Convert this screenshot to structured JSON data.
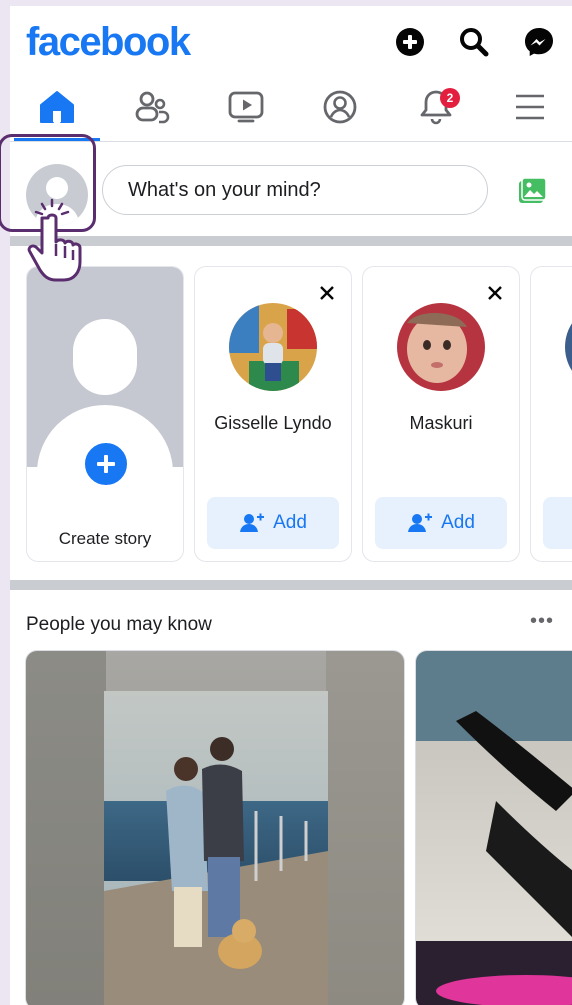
{
  "app": {
    "logo": "facebook"
  },
  "header": {
    "icons": [
      "create-icon",
      "search-icon",
      "messenger-icon"
    ]
  },
  "nav": {
    "tabs": [
      "home-tab",
      "friends-tab",
      "video-tab",
      "profile-tab",
      "notifications-tab",
      "menu-tab"
    ],
    "notification_count": "2"
  },
  "composer": {
    "placeholder": "What's on your mind?"
  },
  "stories": {
    "create_label": "Create story",
    "suggestions": [
      {
        "name": "Gisselle Lyndo",
        "add_label": "Add"
      },
      {
        "name": "Maskuri",
        "add_label": "Add"
      }
    ]
  },
  "pymk": {
    "title": "People you may know",
    "more": "•••"
  },
  "colors": {
    "brand": "#1877f2",
    "badge": "#e41e3f",
    "cursor": "#5a2d6e"
  }
}
